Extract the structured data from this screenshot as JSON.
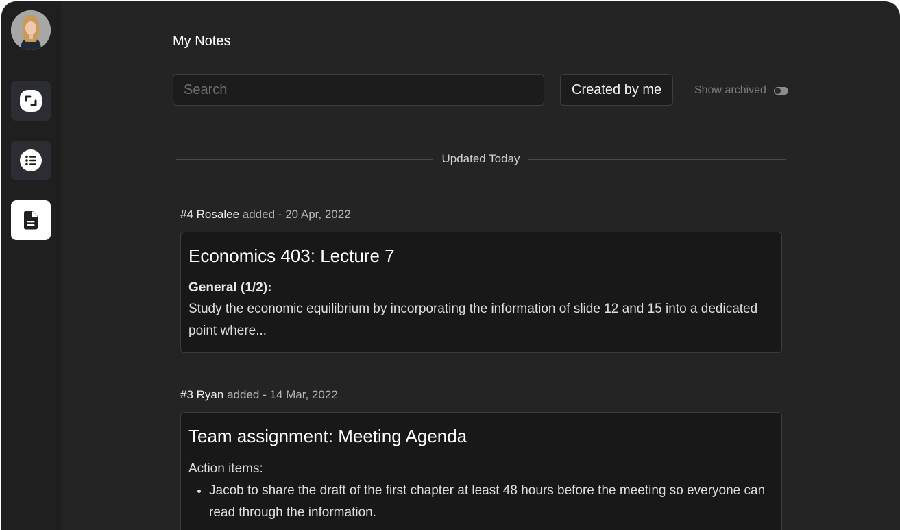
{
  "page": {
    "title": "My Notes"
  },
  "toolbar": {
    "search_placeholder": "Search",
    "filter_label": "Created by me",
    "archived_label": "Show archived",
    "archived_on": false
  },
  "sidebar": {
    "items": [
      {
        "icon": "expand-icon",
        "active": false
      },
      {
        "icon": "list-icon",
        "active": false
      },
      {
        "icon": "document-icon",
        "active": true
      }
    ]
  },
  "section": {
    "label": "Updated Today"
  },
  "notes": [
    {
      "number": "#4",
      "author": "Rosalee",
      "action": "added",
      "date": "20 Apr, 2022",
      "title": "Economics 403: Lecture 7",
      "subheading": "General (1/2):",
      "body": "Study the economic equilibrium by incorporating the information of slide 12 and 15 into a dedicated point where..."
    },
    {
      "number": "#3",
      "author": "Ryan",
      "action": "added",
      "date": "14 Mar, 2022",
      "title": "Team assignment: Meeting Agenda",
      "subheading": "Action items:",
      "items": [
        "Jacob to share the draft of the first chapter at least 48 hours before the meeting so everyone can read through the information."
      ]
    }
  ],
  "colors": {
    "background": "#242424",
    "sidebar": "#1f1f1f",
    "card": "#181818",
    "active_nav": "#ffffff"
  }
}
